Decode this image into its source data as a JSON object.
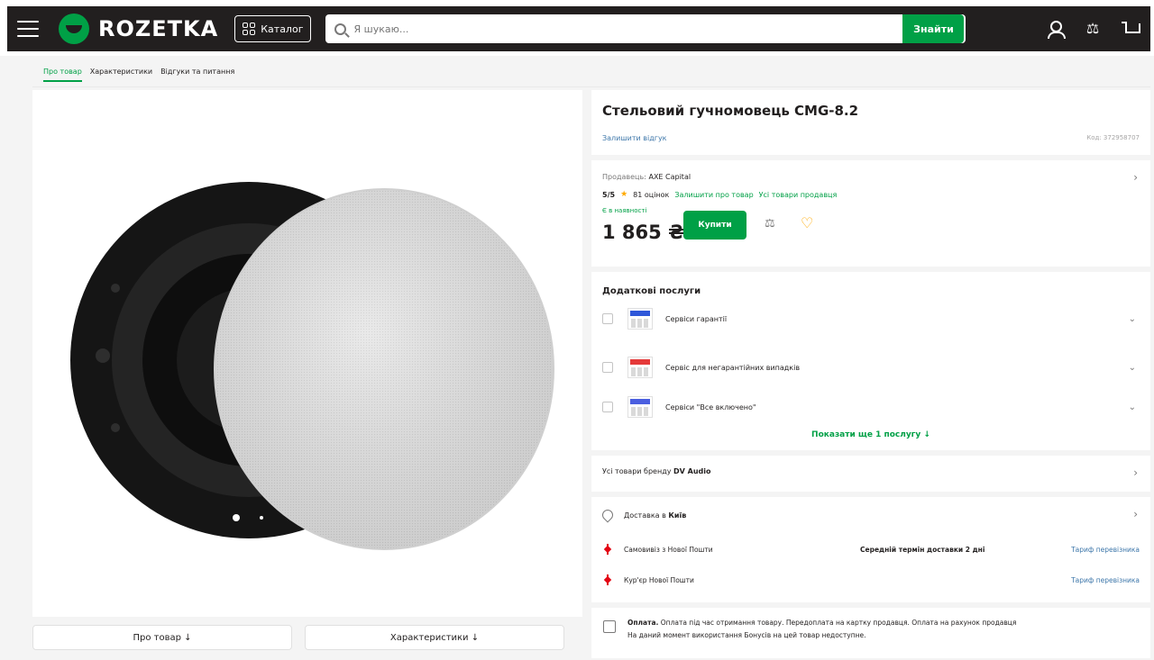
{
  "header": {
    "logo_text": "ROZETKA",
    "catalog_label": "Каталог",
    "search_placeholder": "Я шукаю...",
    "search_button": "Знайти"
  },
  "tabs": [
    "Про товар",
    "Характеристики",
    "Відгуки та питання"
  ],
  "gallery": {
    "bottom_buttons": [
      "Про товар ↓",
      "Характеристики ↓"
    ]
  },
  "product": {
    "title": "Стельовий гучномовець CMG-8.2",
    "review_link": "Залишити відгук",
    "code": "Код: 372958707"
  },
  "seller": {
    "label": "Продавець:",
    "name": "AXE Capital",
    "rating": "5/5",
    "ratings_count": "81 оцінок",
    "complain_link": "Залишити про товар",
    "all_goods_link": "Усі товари продавця",
    "availability": "Є в наявності",
    "price": "1 865 ₴",
    "buy_button": "Купити"
  },
  "services": {
    "title": "Додаткові послуги",
    "items": [
      {
        "label": "Сервіси гарантії",
        "color": "#2f57d9"
      },
      {
        "label": "Сервіс для негарантійних випадків",
        "color": "#e53a3a"
      },
      {
        "label": "Сервіси \"Все включено\"",
        "color": "#4b5fe0"
      }
    ],
    "show_more": "Показати ще 1 послугу ↓"
  },
  "brand": {
    "prefix": "Усі товари бренду",
    "name": "DV Audio"
  },
  "delivery": {
    "title_prefix": "Доставка в",
    "city": "Київ",
    "rows": [
      {
        "label": "Самовивіз з Нової Пошти",
        "mid": "Середній термін доставки 2 дні",
        "right": "Тариф перевізника"
      },
      {
        "label": "Кур'єр Нової Пошти",
        "mid": "",
        "right": "Тариф перевізника"
      }
    ]
  },
  "payment": {
    "label": "Оплата.",
    "text": "Оплата під час отримання товару. Передоплата на картку продавця. Оплата на рахунок продавця",
    "note": "На даний момент використання Бонусів на цей товар недоступне."
  },
  "colors": {
    "brand_green": "#00a046",
    "header_dark": "#221f1f",
    "rating_star": "#ffa900"
  }
}
